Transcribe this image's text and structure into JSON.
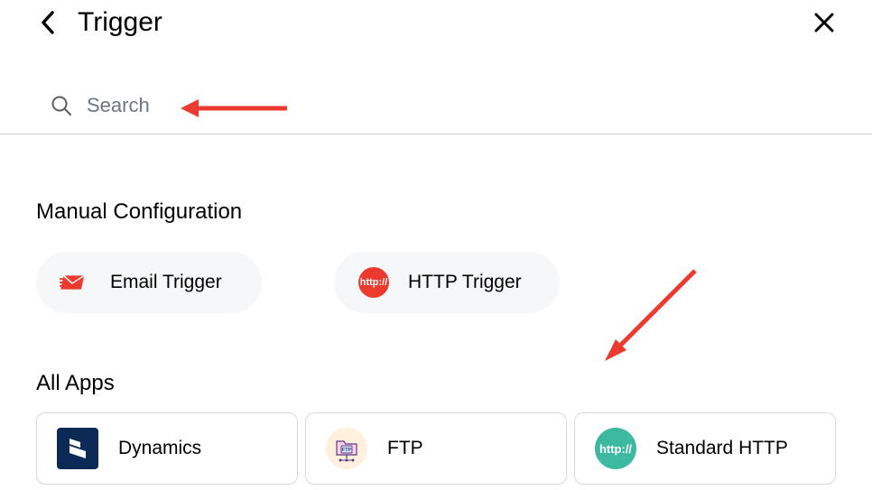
{
  "header": {
    "title": "Trigger"
  },
  "search": {
    "placeholder": "Search"
  },
  "sections": {
    "manual_title": "Manual Configuration",
    "all_apps_title": "All Apps"
  },
  "manual_items": [
    {
      "label": "Email Trigger",
      "icon": "email-send-icon"
    },
    {
      "label": "HTTP Trigger",
      "icon": "http-badge-icon",
      "badge_text": "http://"
    }
  ],
  "app_items": [
    {
      "label": "Dynamics",
      "icon": "dynamics-icon"
    },
    {
      "label": "FTP",
      "icon": "ftp-icon",
      "badge_text": "FTP"
    },
    {
      "label": "Standard HTTP",
      "icon": "standard-http-icon",
      "badge_text": "http://"
    }
  ],
  "colors": {
    "red_accent": "#eb3b2e",
    "card_bg": "#f6f7f8",
    "border": "#d8d8d8",
    "dynamics_blue": "#0b2a56",
    "ftp_peach": "#fff0de",
    "stdhttp_teal": "#3cb9a0"
  }
}
